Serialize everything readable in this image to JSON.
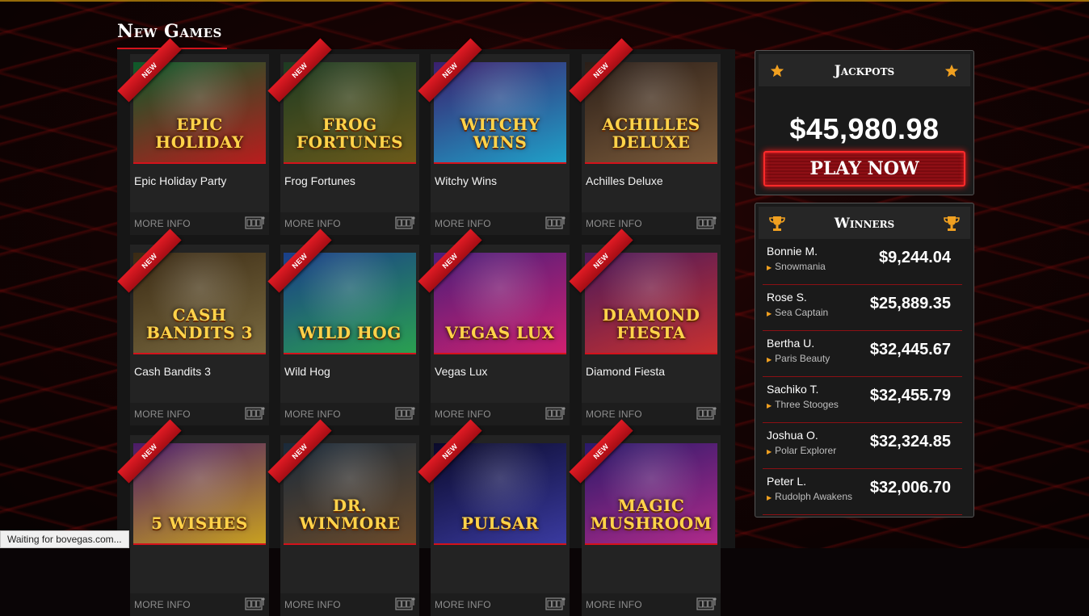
{
  "section": {
    "title": "New Games"
  },
  "badge": "NEW",
  "card_footer_label": "MORE INFO",
  "games": [
    {
      "name": "Epic Holiday Party",
      "art_text": "EPIC HOLIDAY",
      "c1": "#0d5a2a",
      "c2": "#b81d1d"
    },
    {
      "name": "Frog Fortunes",
      "art_text": "FROG FORTUNES",
      "c1": "#1e3b22",
      "c2": "#6b5a1a"
    },
    {
      "name": "Witchy Wins",
      "art_text": "WITCHY WINS",
      "c1": "#3a1f6e",
      "c2": "#1fa0c8"
    },
    {
      "name": "Achilles Deluxe",
      "art_text": "ACHILLES DELUXE",
      "c1": "#2a1e18",
      "c2": "#7a5a3a"
    },
    {
      "name": "Cash Bandits 3",
      "art_text": "CASH BANDITS 3",
      "c1": "#3a2a14",
      "c2": "#7a6a40"
    },
    {
      "name": "Wild Hog",
      "art_text": "WILD HOG",
      "c1": "#1a3e8a",
      "c2": "#2aa050"
    },
    {
      "name": "Vegas Lux",
      "art_text": "VEGAS LUX",
      "c1": "#4a1e7a",
      "c2": "#d02070"
    },
    {
      "name": "Diamond Fiesta",
      "art_text": "DIAMOND FIESTA",
      "c1": "#4a1a5a",
      "c2": "#c83030"
    },
    {
      "name": "",
      "art_text": "5 WISHES",
      "c1": "#4a1a6a",
      "c2": "#c8a020"
    },
    {
      "name": "",
      "art_text": "DR. WINMORE",
      "c1": "#1a2a3a",
      "c2": "#6a4a2a"
    },
    {
      "name": "",
      "art_text": "PULSAR",
      "c1": "#0a0a2a",
      "c2": "#3a3aa0"
    },
    {
      "name": "",
      "art_text": "MAGIC MUSHROOM",
      "c1": "#2a1a6a",
      "c2": "#b02a8a"
    }
  ],
  "jackpots": {
    "title": "Jackpots",
    "amount": "$45,980.98",
    "play_label": "PLAY NOW"
  },
  "winners": {
    "title": "Winners",
    "rows": [
      {
        "name": "Bonnie M.",
        "game": "Snowmania",
        "amount": "$9,244.04"
      },
      {
        "name": "Rose S.",
        "game": "Sea Captain",
        "amount": "$25,889.35"
      },
      {
        "name": "Bertha U.",
        "game": "Paris Beauty",
        "amount": "$32,445.67"
      },
      {
        "name": "Sachiko T.",
        "game": "Three Stooges",
        "amount": "$32,455.79"
      },
      {
        "name": "Joshua O.",
        "game": "Polar Explorer",
        "amount": "$32,324.85"
      },
      {
        "name": "Peter L.",
        "game": "Rudolph Awakens",
        "amount": "$32,006.70"
      }
    ]
  },
  "status": {
    "text": "Waiting for bovegas.com..."
  },
  "colors": {
    "accent_red": "#d4121b",
    "gold_icon": "#f0a020"
  }
}
